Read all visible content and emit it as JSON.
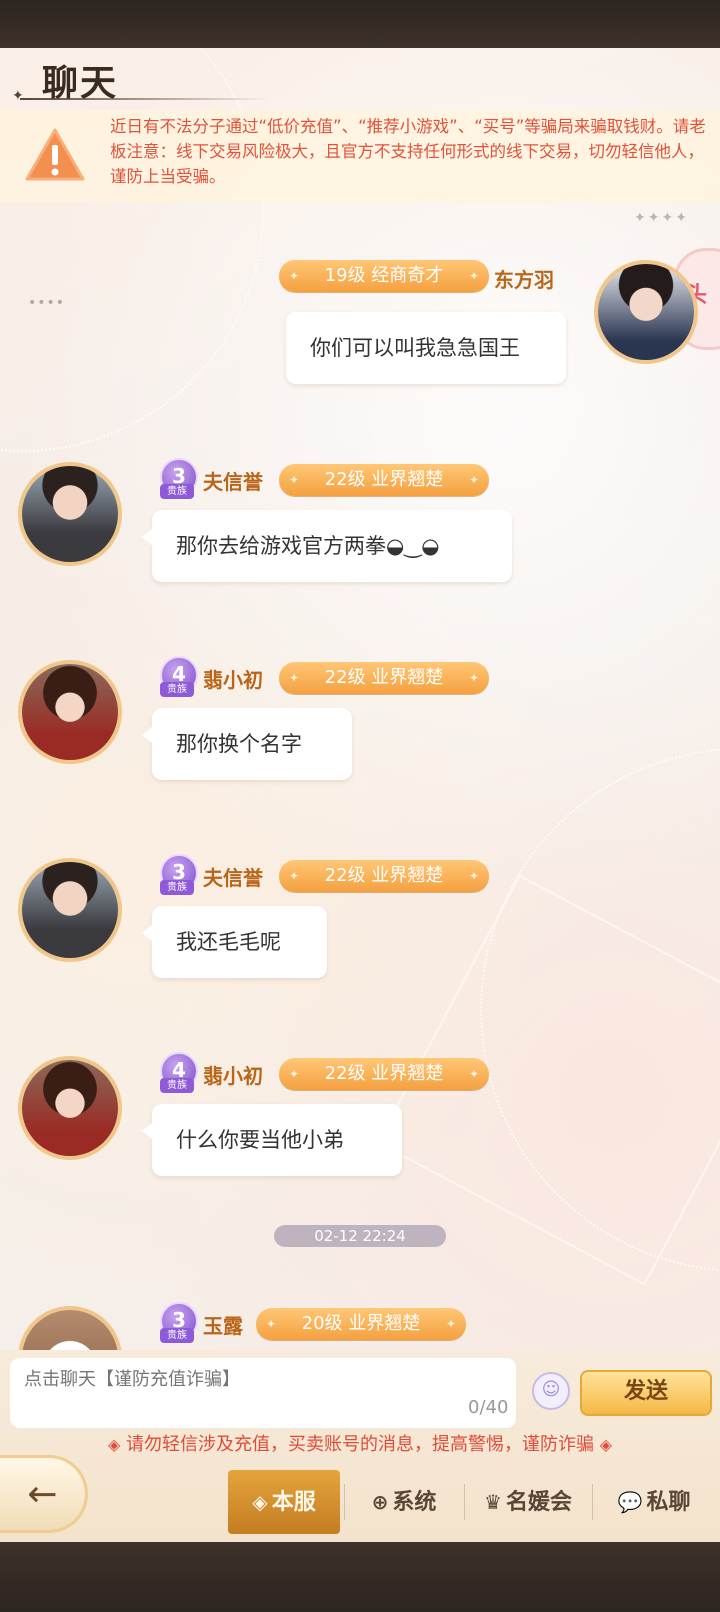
{
  "header": {
    "title": "聊天"
  },
  "notice": {
    "text": "近日有不法分子通过“低价充值”、“推荐小游戏”、“买号”等骗局来骗取钱财。请老板注意：线下交易风险极大，且官方不支持任何形式的线下交易，切勿轻信他人，谨防上当受骗。"
  },
  "side_badge": {
    "label": "头"
  },
  "messages": [
    {
      "side": "right",
      "username": "东方羽",
      "level": "19级 经商奇才",
      "text": "你们可以叫我急急国王",
      "avatar": "male-glasses-avatar"
    },
    {
      "side": "left",
      "username": "夫信誉",
      "rank": "3",
      "rank_tag": "贵族",
      "level": "22级 业界翘楚",
      "text": "那你去给游戏官方两拳◒‿◒",
      "avatar": "male-avatar"
    },
    {
      "side": "left",
      "username": "翡小初",
      "rank": "4",
      "rank_tag": "贵族",
      "level": "22级 业界翘楚",
      "text": "那你换个名字",
      "avatar": "female-avatar"
    },
    {
      "side": "left",
      "username": "夫信誉",
      "rank": "3",
      "rank_tag": "贵族",
      "level": "22级 业界翘楚",
      "text": "我还毛毛呢",
      "avatar": "male-avatar"
    },
    {
      "side": "left",
      "username": "翡小初",
      "rank": "4",
      "rank_tag": "贵族",
      "level": "22级 业界翘楚",
      "text": "什么你要当他小弟",
      "avatar": "female-avatar"
    },
    {
      "side": "left",
      "username": "玉露",
      "rank": "3",
      "rank_tag": "贵族",
      "level": "20级 业界翘楚",
      "text": "",
      "avatar": "white-hat-avatar"
    }
  ],
  "timestamp": "02-12 22:24",
  "composer": {
    "placeholder": "点击聊天【谨防充值诈骗】",
    "counter": "0/40",
    "send_label": "发送",
    "emoji_icon": "smile-icon"
  },
  "warning_line": "请勿轻信涉及充值，买卖账号的消息，提高警惕，谨防诈骗",
  "tabs": [
    {
      "label": "本服",
      "icon": "diamond-icon",
      "active": true
    },
    {
      "label": "系统",
      "icon": "globe-icon",
      "active": false
    },
    {
      "label": "名媛会",
      "icon": "crown-icon",
      "active": false
    },
    {
      "label": "私聊",
      "icon": "chat-icon",
      "active": false
    }
  ],
  "colors": {
    "accent": "#f4a040",
    "warning": "#e0523a",
    "username": "#b9661a"
  }
}
